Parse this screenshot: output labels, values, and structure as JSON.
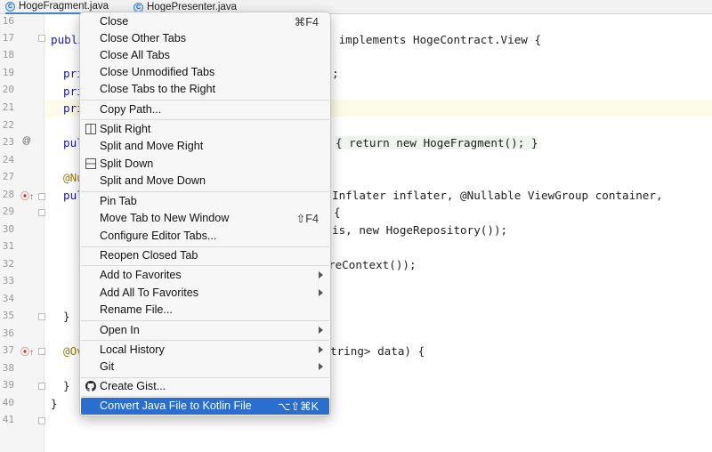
{
  "tabs": [
    {
      "label": "HogeFragment.java",
      "icon": "java-class-icon",
      "active": true
    },
    {
      "label": "HogePresenter.java",
      "icon": "java-class-icon",
      "active": false
    }
  ],
  "gutter": {
    "line_numbers": [
      "16",
      "17",
      "18",
      "19",
      "20",
      "21",
      "22",
      "23",
      "24",
      "27",
      "28",
      "29",
      "30",
      "31",
      "32",
      "33",
      "34",
      "35",
      "36",
      "37",
      "38",
      "39",
      "40",
      "41"
    ]
  },
  "code_lines": [
    {
      "pre": "publi",
      "frag": " implements HogeContract.View {"
    },
    {
      "pre": "pri",
      "frag": ";"
    },
    {
      "pre": "pri",
      "frag": ""
    },
    {
      "pre": "pri",
      "frag": ""
    },
    {
      "pre": "pul",
      "frag": "{ return new HogeFragment(); }"
    },
    {
      "pre": "@Nu",
      "frag": ""
    },
    {
      "pre": "pul",
      "frag": "Inflater inflater, @Nullable ViewGroup container,"
    },
    {
      "pre": "",
      "frag": "{"
    },
    {
      "pre": "",
      "frag": "is, new HogeRepository());"
    },
    {
      "pre": "",
      "frag": "reContext());"
    },
    {
      "pre": "}",
      "frag": ""
    },
    {
      "pre": "@Ov",
      "frag": "tring> data) {"
    },
    {
      "pre": "}",
      "frag": ""
    },
    {
      "pre": "}",
      "frag": ""
    }
  ],
  "menu": {
    "groups": [
      [
        {
          "label": "Close",
          "shortcut": "⌘F4"
        },
        {
          "label": "Close Other Tabs"
        },
        {
          "label": "Close All Tabs"
        },
        {
          "label": "Close Unmodified Tabs"
        },
        {
          "label": "Close Tabs to the Right"
        }
      ],
      [
        {
          "label": "Copy Path..."
        }
      ],
      [
        {
          "label": "Split Right",
          "icon": "split-right-icon"
        },
        {
          "label": "Split and Move Right"
        },
        {
          "label": "Split Down",
          "icon": "split-down-icon"
        },
        {
          "label": "Split and Move Down"
        }
      ],
      [
        {
          "label": "Pin Tab"
        },
        {
          "label": "Move Tab to New Window",
          "shortcut": "⇧F4"
        },
        {
          "label": "Configure Editor Tabs..."
        }
      ],
      [
        {
          "label": "Reopen Closed Tab"
        }
      ],
      [
        {
          "label": "Add to Favorites",
          "submenu": true
        },
        {
          "label": "Add All To Favorites",
          "submenu": true
        },
        {
          "label": "Rename File..."
        }
      ],
      [
        {
          "label": "Open In",
          "submenu": true
        }
      ],
      [
        {
          "label": "Local History",
          "submenu": true
        },
        {
          "label": "Git",
          "submenu": true
        }
      ],
      [
        {
          "label": "Create Gist...",
          "icon": "github-icon"
        }
      ],
      [
        {
          "label": "Convert Java File to Kotlin File",
          "shortcut": "⌥⇧⌘K",
          "selected": true
        }
      ]
    ]
  },
  "colors": {
    "selection": "#2a6fcf",
    "keyword": "#1a1aa6",
    "annotation": "#9b7a14"
  }
}
